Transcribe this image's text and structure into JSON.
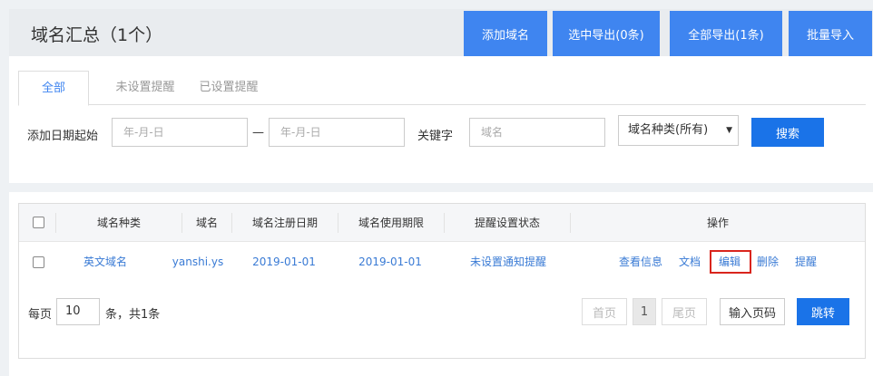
{
  "header": {
    "title": "域名汇总（1个）",
    "buttons": {
      "add": "添加域名",
      "export_selected": "选中导出(0条)",
      "export_all": "全部导出(1条)",
      "bulk_import": "批量导入"
    }
  },
  "filters": {
    "tabs": [
      "全部",
      "未设置提醒",
      "已设置提醒"
    ],
    "date_label": "添加日期起始",
    "date_start_placeholder": "年-月-日",
    "date_separator": "—",
    "date_end_placeholder": "年-月-日",
    "keyword_label": "关键字",
    "keyword_placeholder": "域名",
    "type_select": "域名种类(所有)",
    "search_button": "搜索"
  },
  "table": {
    "columns": [
      "域名种类",
      "域名",
      "域名注册日期",
      "域名使用期限",
      "提醒设置状态",
      "操作"
    ],
    "rows": [
      {
        "type": "英文域名",
        "domain": "yanshi.ys",
        "registered": "2019-01-01",
        "expires": "2019-01-01",
        "reminder_status": "未设置通知提醒",
        "actions": [
          "查看信息",
          "文档",
          "编辑",
          "删除",
          "提醒"
        ]
      }
    ]
  },
  "pager": {
    "per_page_label": "每页",
    "per_page_value": "10",
    "total_text": "条，共1条",
    "first": "首页",
    "current_page": "1",
    "last": "尾页",
    "page_input": "输入页码",
    "jump": "跳转"
  },
  "colors": {
    "primary": "#3f85f0",
    "link": "#3a7bd5",
    "highlight_border": "#d9251d"
  }
}
